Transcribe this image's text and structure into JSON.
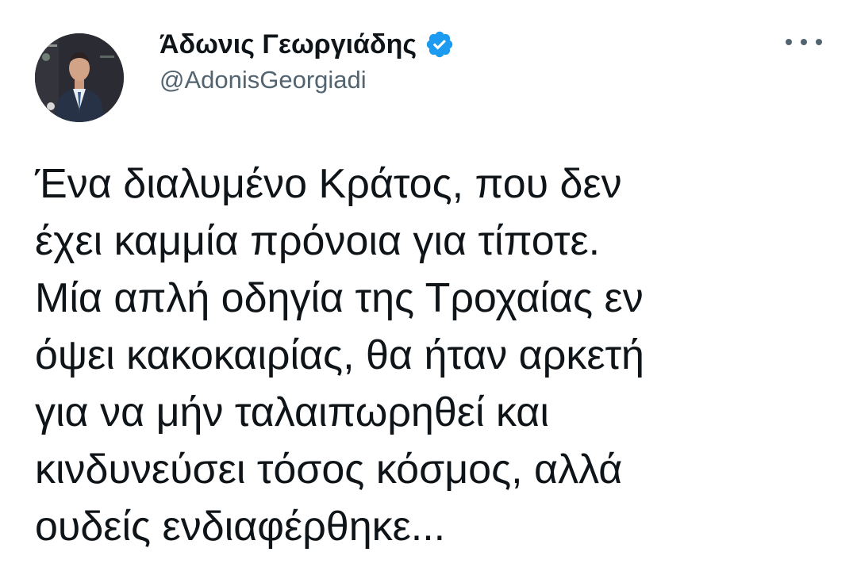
{
  "author": {
    "display_name": "Άδωνις Γεωργιάδης",
    "handle": "@AdonisGeorgiadi",
    "verified": true,
    "verified_color": "#1d9bf0"
  },
  "icons": {
    "verified": "verified-badge-icon",
    "more": "more-options-icon"
  },
  "tweet": {
    "lines": [
      "Ένα διαλυμένο Κράτος, που δεν",
      "έχει καμμία πρόνοια για τίποτε.",
      "Μία απλή οδηγία της Τροχαίας εν",
      "όψει κακοκαιρίας, θα ήταν αρκετή",
      "για να μήν ταλαιπωρηθεί και",
      "κινδυνεύσει τόσος κόσμος, αλλά",
      "ουδείς ενδιαφέρθηκε..."
    ]
  }
}
